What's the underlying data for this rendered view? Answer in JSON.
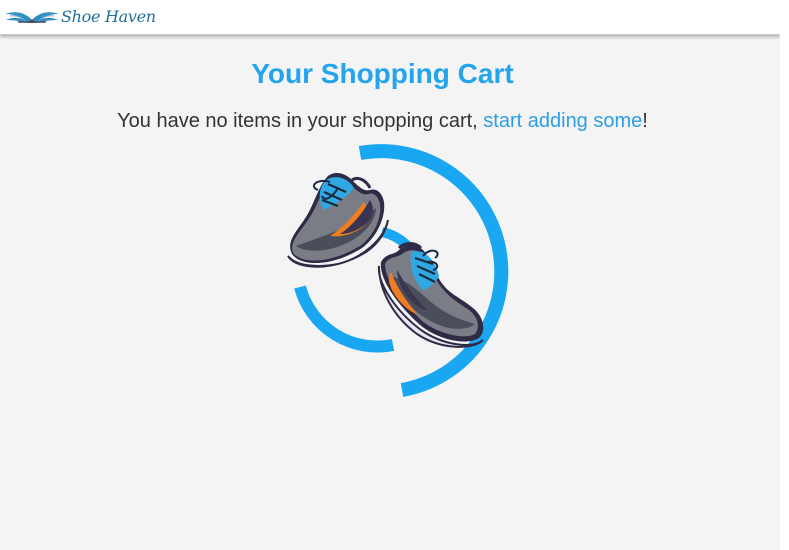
{
  "header": {
    "logo_text": "Shoe Haven",
    "logo_icon": "wings-logo-icon"
  },
  "cart": {
    "title": "Your Shopping Cart",
    "empty_message_prefix": "You have no items in your shopping cart, ",
    "empty_message_link": "start adding some",
    "empty_message_suffix": "!",
    "illustration_icon": "sneakers-icon"
  },
  "colors": {
    "accent": "#23a4ec",
    "link": "#2b9fe6",
    "text": "#333333",
    "background": "#f4f4f4",
    "navbar": "#ffffff"
  }
}
